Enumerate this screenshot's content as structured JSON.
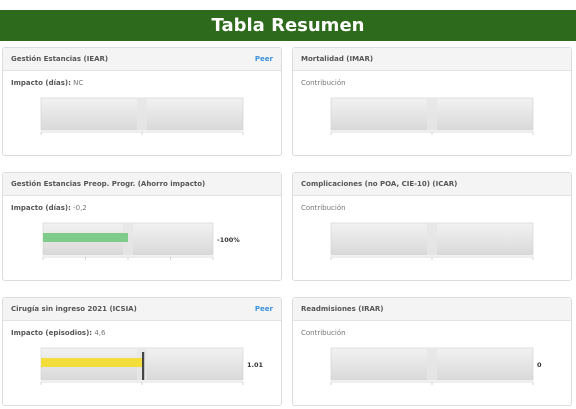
{
  "title": "Tabla Resumen",
  "colors": {
    "banner": "#2e6a1c",
    "green_bar": "#7fcb8a",
    "yellow_bar": "#f3dd3a",
    "link": "#3b8fd9"
  },
  "cards": [
    {
      "title": "Gestión Estancias (IEAR)",
      "link": "Peer",
      "label": "Impacto (días):",
      "value": "NC",
      "chart": {
        "ticks": [
          "0",
          "1",
          "2"
        ],
        "min": 0,
        "max": 2,
        "value": null,
        "marker": null,
        "marker_label": ""
      }
    },
    {
      "title": "Mortalidad (IMAR)",
      "link": "",
      "label": "Contribución",
      "value": "",
      "chart": {
        "ticks": [
          "0",
          "1",
          "2"
        ],
        "min": 0,
        "max": 2,
        "value": null,
        "marker": null,
        "marker_label": ""
      }
    },
    {
      "title": "Gestión Estancias Preop. Progr. (Ahorro impacto)",
      "link": "",
      "label": "Impacto (días):",
      "value": "-0,2",
      "chart": {
        "ticks": [
          "-100%",
          "-50%",
          "0%",
          "50%",
          "100%"
        ],
        "min": -100,
        "max": 100,
        "value": -100,
        "marker": null,
        "marker_label": "-100%"
      }
    },
    {
      "title": "Complicaciones (no POA, CIE-10) (ICAR)",
      "link": "",
      "label": "Contribución",
      "value": "",
      "chart": {
        "ticks": [
          "0",
          "1",
          "2"
        ],
        "min": 0,
        "max": 2,
        "value": null,
        "marker": null,
        "marker_label": ""
      }
    },
    {
      "title": "Cirugía sin ingreso 2021 (ICSIA)",
      "link": "Peer",
      "label": "Impacto (episodios):",
      "value": "4,6",
      "chart": {
        "ticks": [
          "0",
          "1",
          "2"
        ],
        "min": 0,
        "max": 2,
        "value": 1.01,
        "marker": 1.01,
        "marker_label": "1.01"
      }
    },
    {
      "title": "Readmisiones (IRAR)",
      "link": "",
      "label": "Contribución",
      "value": "",
      "chart": {
        "ticks": [
          "0",
          "1",
          "2"
        ],
        "min": 0,
        "max": 2,
        "value": null,
        "marker": null,
        "marker_label": "0"
      }
    }
  ]
}
